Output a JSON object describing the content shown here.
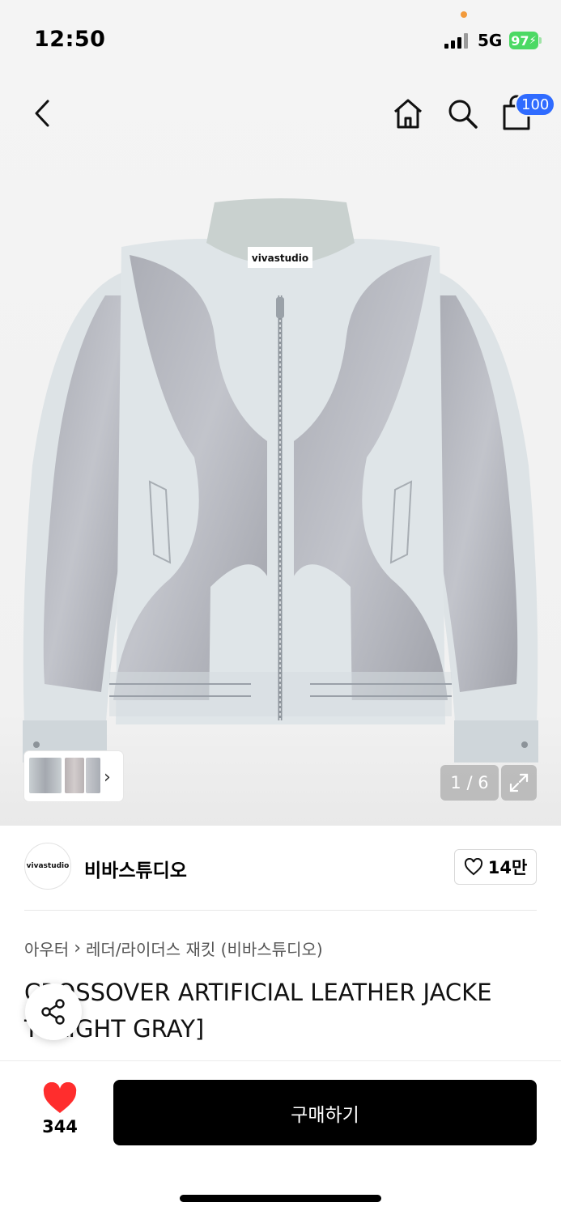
{
  "status_bar": {
    "time": "12:50",
    "network": "5G",
    "battery": "97"
  },
  "header": {
    "back_icon": "chevron-left-icon",
    "home_icon": "home-icon",
    "search_icon": "search-icon",
    "cart_icon": "shopping-bag-icon",
    "cart_badge": "100"
  },
  "gallery": {
    "counter": "1 / 6",
    "expand_icon": "expand-icon",
    "thumb_arrow": "›",
    "image_logo_text": "vivastudio"
  },
  "brand": {
    "logo_text": "vivastudio",
    "name": "비바스튜디오",
    "like_count": "14만"
  },
  "product": {
    "breadcrumb": [
      "아우터",
      "레더/라이더스 재킷 (비바스튜디오)"
    ],
    "title_line1": "CROSSOVER ARTIFICIAL LEATHER JACKE",
    "title_line2": "T [LIGHT GRAY]"
  },
  "bottom_bar": {
    "heart_count": "344",
    "buy_label": "구매하기"
  },
  "colors": {
    "accent_blue": "#2f6bff",
    "heart_red": "#ff2d2d",
    "battery_green": "#4cd964"
  }
}
